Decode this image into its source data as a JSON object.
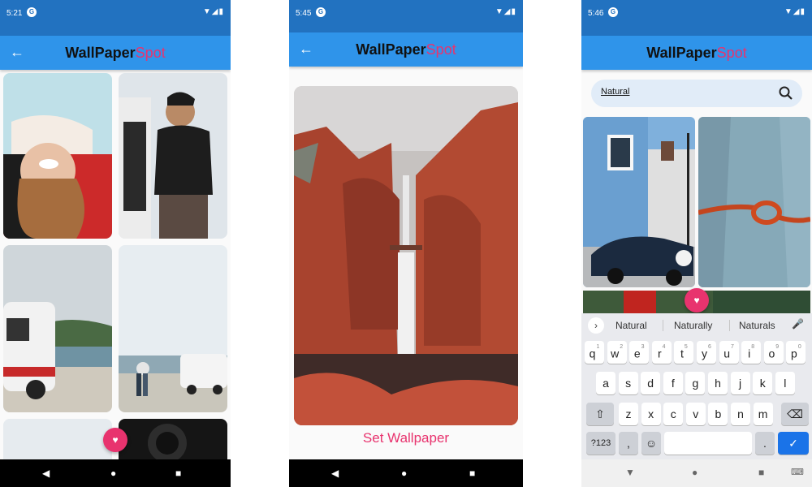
{
  "screens": [
    {
      "time": "5:21",
      "title_part1": "WallPaper",
      "title_part2": "Spot"
    },
    {
      "time": "5:45",
      "title_part1": "WallPaper",
      "title_part2": "Spot",
      "action_label": "Set Wallpaper"
    },
    {
      "time": "5:46",
      "title_part1": "WallPaper",
      "title_part2": "Spot",
      "search_value": "Natural",
      "suggestions": [
        "Natural",
        "Naturally",
        "Naturals"
      ],
      "keyboard": {
        "row1": [
          "q",
          "w",
          "e",
          "r",
          "t",
          "y",
          "u",
          "i",
          "o",
          "p"
        ],
        "row1_hints": [
          "1",
          "2",
          "3",
          "4",
          "5",
          "6",
          "7",
          "8",
          "9",
          "0"
        ],
        "row2": [
          "a",
          "s",
          "d",
          "f",
          "g",
          "h",
          "j",
          "k",
          "l"
        ],
        "row3": [
          "z",
          "x",
          "c",
          "v",
          "b",
          "n",
          "m"
        ],
        "symbols_label": "?123",
        "comma": ",",
        "period": "."
      }
    }
  ],
  "icons": {
    "status_g": "G",
    "status_right": "▼◢▮",
    "back_arrow": "←",
    "nav_back": "◀",
    "nav_home": "●",
    "nav_recent": "■",
    "favorite_fab": "♥",
    "chevron": "›",
    "mic": "🎤",
    "shift": "⇧",
    "backspace": "⌫",
    "emoji": "☺",
    "check": "✓",
    "kb_hide": "▼",
    "kb_switch": "⌨"
  },
  "colors": {
    "status_bar": "#2272c0",
    "app_bar": "#2f94ea",
    "accent": "#e8336e",
    "keyboard_bg": "#e9eaee",
    "enter_key": "#1a73e8"
  }
}
